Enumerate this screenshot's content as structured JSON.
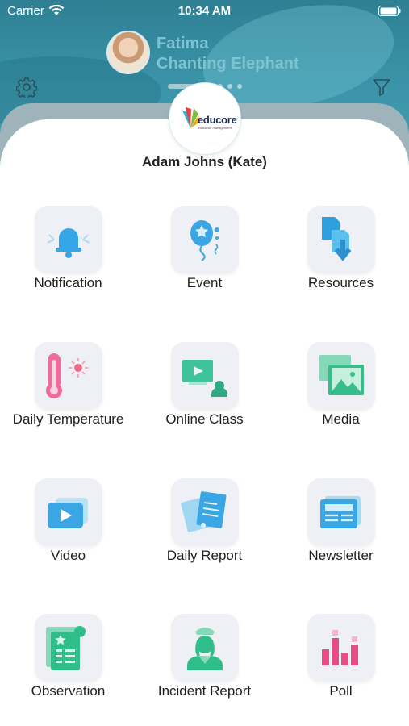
{
  "status_bar": {
    "carrier": "Carrier",
    "time": "10:34 AM"
  },
  "profile": {
    "name": "Fatima",
    "class_name": "Chanting Elephant"
  },
  "logo": {
    "brand": "educore",
    "tagline": "education management"
  },
  "user": {
    "name": "Adam Johns (Kate)"
  },
  "menu": [
    {
      "label": "Notification",
      "icon": "bell-icon"
    },
    {
      "label": "Event",
      "icon": "balloon-icon"
    },
    {
      "label": "Resources",
      "icon": "resources-icon"
    },
    {
      "label": "Daily Temperature",
      "icon": "thermometer-icon"
    },
    {
      "label": "Online Class",
      "icon": "online-class-icon"
    },
    {
      "label": "Media",
      "icon": "media-icon"
    },
    {
      "label": "Video",
      "icon": "video-icon"
    },
    {
      "label": "Daily Report",
      "icon": "daily-report-icon"
    },
    {
      "label": "Newsletter",
      "icon": "newsletter-icon"
    },
    {
      "label": "Observation",
      "icon": "observation-icon"
    },
    {
      "label": "Incident Report",
      "icon": "nurse-icon"
    },
    {
      "label": "Poll",
      "icon": "poll-icon"
    }
  ],
  "colors": {
    "header": "#3a93a8",
    "accent_blue": "#3aa6e3",
    "accent_pink": "#e94b88",
    "accent_green": "#2ec090"
  }
}
